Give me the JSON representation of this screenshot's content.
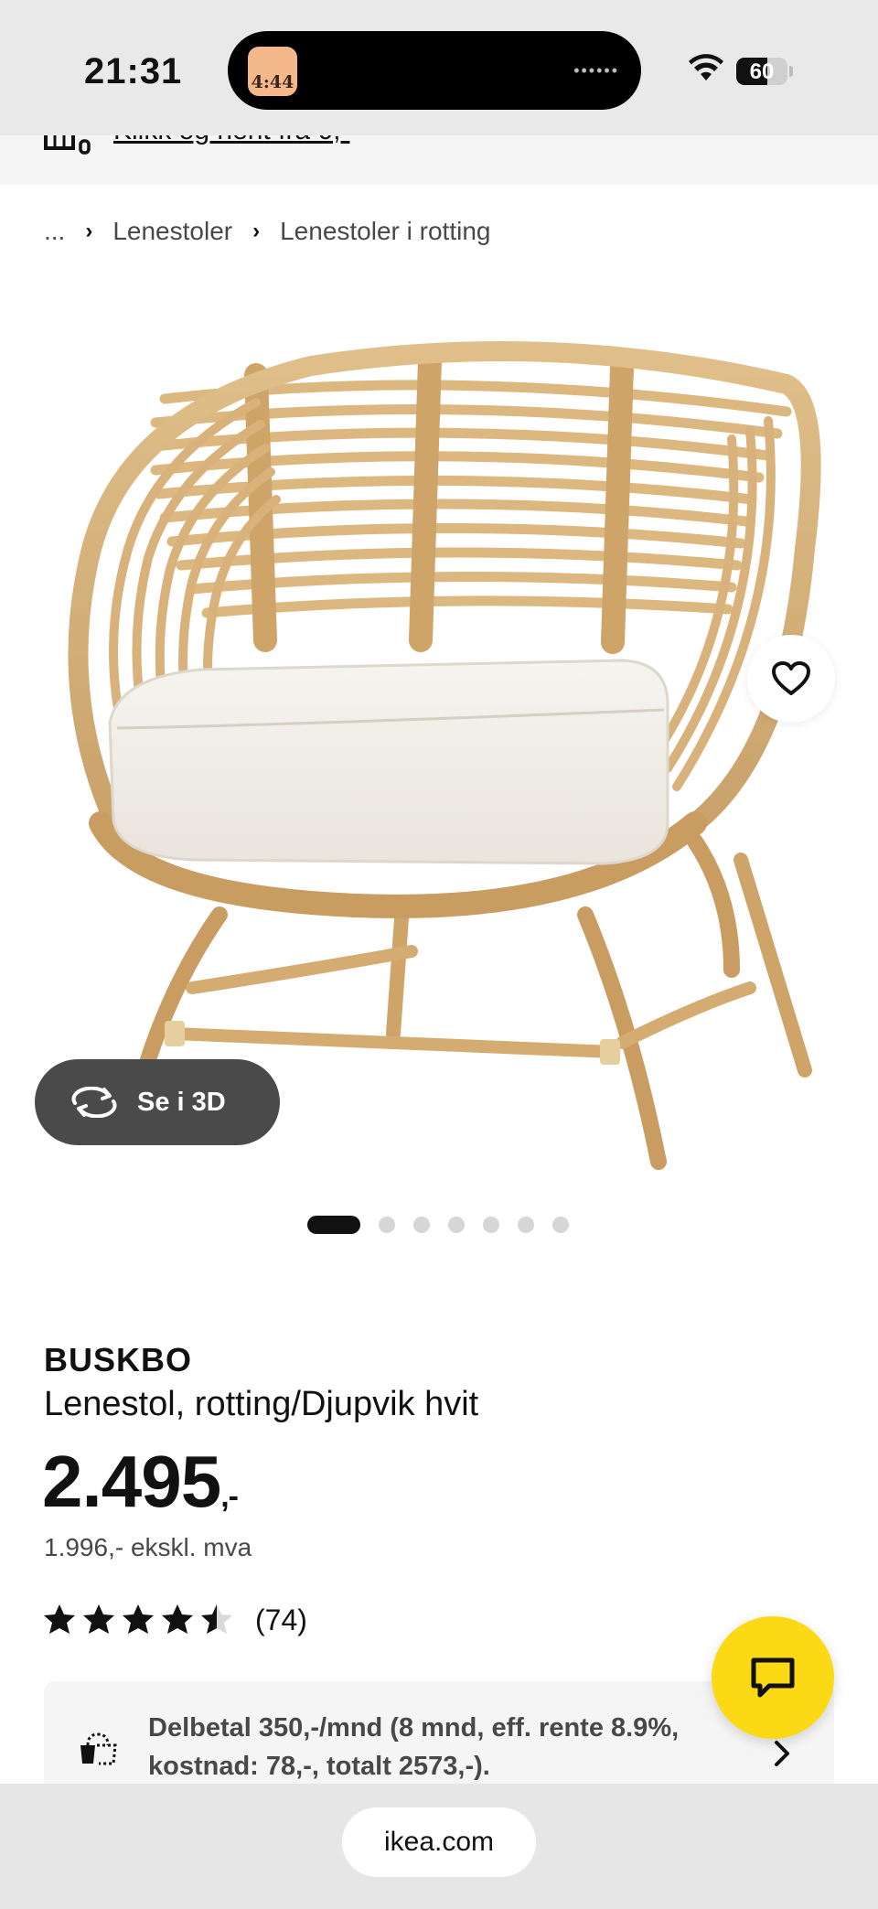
{
  "status_bar": {
    "time": "21:31",
    "island_app_time": "4:44",
    "battery_percent": "60",
    "battery_level": 0.6
  },
  "promo": {
    "text": "Klikk og hent fra 0,-"
  },
  "breadcrumb": {
    "items": [
      "...",
      "Lenestoler",
      "Lenestoler i rotting"
    ]
  },
  "media": {
    "view3d_label": "Se i 3D",
    "image_count": 7,
    "active_index": 0
  },
  "product": {
    "brand": "BUSKBO",
    "description": "Lenestol, rotting/Djupvik hvit",
    "price": "2.495",
    "price_suffix": ",-",
    "price_ex_vat": "1.996,- ekskl. mva",
    "rating": 4.5,
    "rating_count": "(74)"
  },
  "financing": {
    "text": "Delbetal 350,-/mnd (8 mnd, eff. rente 8.9%, kostnad: 78,-, totalt 2573,-)."
  },
  "browser": {
    "url": "ikea.com"
  },
  "colors": {
    "chat_fab": "#fbd914",
    "view3d_button": "#4a4a4a",
    "price": "#111111"
  },
  "icons": [
    "wifi-icon",
    "battery-icon",
    "truck-icon",
    "heart-icon",
    "rotate-3d-icon",
    "star-icon",
    "chat-icon",
    "installment-icon",
    "chevron-right-icon"
  ]
}
